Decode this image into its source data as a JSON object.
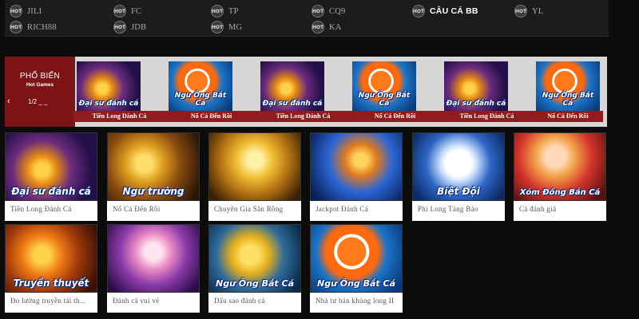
{
  "providers": [
    {
      "badge": "HOT",
      "label": "JILI"
    },
    {
      "badge": "HOT",
      "label": "FC"
    },
    {
      "badge": "HOT",
      "label": "TP"
    },
    {
      "badge": "HOT",
      "label": "CQ9"
    },
    {
      "badge": "HOT",
      "label": "CÂU CÁ BB",
      "active": true
    },
    {
      "badge": "HOT",
      "label": "YL"
    },
    {
      "badge": "HOT",
      "label": "RICH88"
    },
    {
      "badge": "HOT",
      "label": "JDB"
    },
    {
      "badge": "HOT",
      "label": "MG"
    },
    {
      "badge": "HOT",
      "label": "KA"
    }
  ],
  "hot_games": {
    "title": "PHỔ BIẾN",
    "subtitle": "Hot Games",
    "page": "1/2 _ _",
    "prev_icon": "chevron-left-icon",
    "prev_glyph": "‹",
    "items": [
      {
        "title": "Tiền Long Đánh Cá",
        "art_text": "Đại sư đánh cá"
      },
      {
        "title": "Nổ Cá Đến Rồi",
        "art_text": "Ngư Ông Bắt Cá"
      },
      {
        "title": "Tiền Long Đánh Cá",
        "art_text": "Đại sư đánh cá"
      },
      {
        "title": "Nổ Cá Đến Rồi",
        "art_text": "Ngư Ông Bắt Cá"
      },
      {
        "title": "Tiền Long Đánh Cá",
        "art_text": "Đại sư đánh cá"
      },
      {
        "title": "Nổ Cá Đến Rồi",
        "art_text": "Ngư Ông Bắt Cá"
      }
    ]
  },
  "games": [
    {
      "name": "Tiền Long Đánh Cá",
      "art_text": "Đại sư đánh cá"
    },
    {
      "name": "Nổ Cá Đến Rồi",
      "art_text": "Ngư trường"
    },
    {
      "name": "Chuyên Gia Săn Rồng",
      "art_text": ""
    },
    {
      "name": "Jackpot Đánh Cá",
      "art_text": ""
    },
    {
      "name": "Phi Long Tàng Bảo",
      "art_text": "Biệt Đội"
    },
    {
      "name": "Cá đánh giá",
      "art_text": "Xóm Đồng Bắn Cá"
    },
    {
      "name": "Đo lường truyền tải th...",
      "art_text": "Truyền thuyết"
    },
    {
      "name": "Đánh cá vui vẻ",
      "art_text": ""
    },
    {
      "name": "Dấu sao đánh cá",
      "art_text": "Ngư Ông Bắt Cá"
    },
    {
      "name": "Nhà tư bản khủng long II",
      "art_text": "Ngư Ông Bắt Cá"
    }
  ],
  "colors": {
    "page_bg": "#0c0c0c",
    "provider_bar_bg": "#1c1c1c",
    "hot_panel_bg": "#7c1416",
    "hot_strip_bg": "#d6d6d6",
    "hot_title_bar": "#8f1c1e",
    "card_bg": "#ffffff",
    "card_text": "#555555"
  }
}
